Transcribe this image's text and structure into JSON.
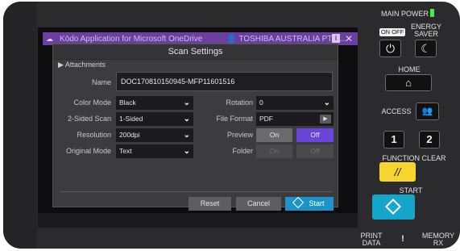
{
  "window": {
    "app_title": "Kōdo Application for Microsoft OneDrive",
    "user_title": "TOSHIBA AUSTRALIA PTY ...",
    "info_label": "i",
    "close_label": "✕"
  },
  "dialog": {
    "title": "Scan Settings",
    "attachments_label": "▶ Attachments",
    "name_label": "Name",
    "name_value": "DOC170810150945-MFP11601516",
    "color_mode_label": "Color Mode",
    "color_mode_value": "Black",
    "sided_scan_label": "2-Sided Scan",
    "sided_scan_value": "1-Sided",
    "resolution_label": "Resolution",
    "resolution_value": "200dpi",
    "original_mode_label": "Original Mode",
    "original_mode_value": "Text",
    "rotation_label": "Rotation",
    "rotation_value": "0",
    "file_format_label": "File Format",
    "file_format_value": "PDF",
    "preview_label": "Preview",
    "preview_on": "On",
    "preview_off": "Off",
    "folder_label": "Folder",
    "folder_on": "On",
    "folder_off": "Off",
    "reset_label": "Reset",
    "cancel_label": "Cancel",
    "start_label": "Start"
  },
  "panel": {
    "main_power": "MAIN POWER",
    "on_off": "ON OFF",
    "energy_saver_line1": "ENERGY",
    "energy_saver_line2": "SAVER",
    "home": "HOME",
    "access": "ACCESS",
    "key_1": "1",
    "key_2": "2",
    "function_clear": "FUNCTION CLEAR",
    "start": "START",
    "print_data_line1": "PRINT",
    "print_data_line2": "DATA",
    "exclamation": "!",
    "memory_rx_line1": "MEMORY",
    "memory_rx_line2": "RX"
  },
  "colors": {
    "title_bar": "#6a3f9e",
    "preview_off_active": "#6a45d8",
    "start_button": "#1c93c9",
    "function_clear_key": "#f6d52f",
    "start_key": "#16a6cc",
    "power_led": "#3ff03a"
  },
  "icons": [
    "cloud-icon",
    "person-icon",
    "chevron-down-icon",
    "play-icon",
    "start-diamond-icon",
    "power-icon",
    "moon-icon",
    "home-icon",
    "access-users-icon",
    "clear-slash-icon"
  ]
}
